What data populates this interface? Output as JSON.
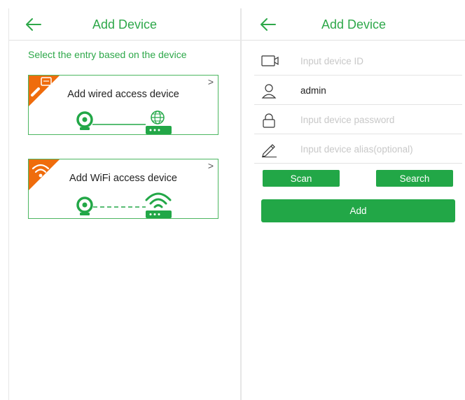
{
  "left": {
    "header": {
      "title": "Add Device",
      "back_icon": "arrow-left-icon"
    },
    "subtitle": "Select the entry based on the device",
    "cards": [
      {
        "label": "Add wired access device",
        "badge_icon": "ethernet-plug-icon",
        "chevron": ">",
        "connection": "wired"
      },
      {
        "label": "Add WiFi access device",
        "badge_icon": "wifi-icon",
        "chevron": ">",
        "connection": "wifi"
      }
    ]
  },
  "right": {
    "header": {
      "title": "Add Device",
      "back_icon": "arrow-left-icon"
    },
    "fields": {
      "device_id": {
        "placeholder": "Input device ID",
        "value": "",
        "icon": "video-camera-icon"
      },
      "username": {
        "value": "admin",
        "icon": "user-icon"
      },
      "password": {
        "placeholder": "Input device password",
        "value": "",
        "icon": "lock-icon"
      },
      "alias": {
        "placeholder": "Input device alias(optional)",
        "value": "",
        "icon": "pencil-icon"
      }
    },
    "buttons": {
      "scan": "Scan",
      "search": "Search",
      "add": "Add"
    }
  },
  "colors": {
    "accent": "#2ea84a",
    "button": "#22a747",
    "badge": "#ef6c0c",
    "border": "#4cb660"
  }
}
